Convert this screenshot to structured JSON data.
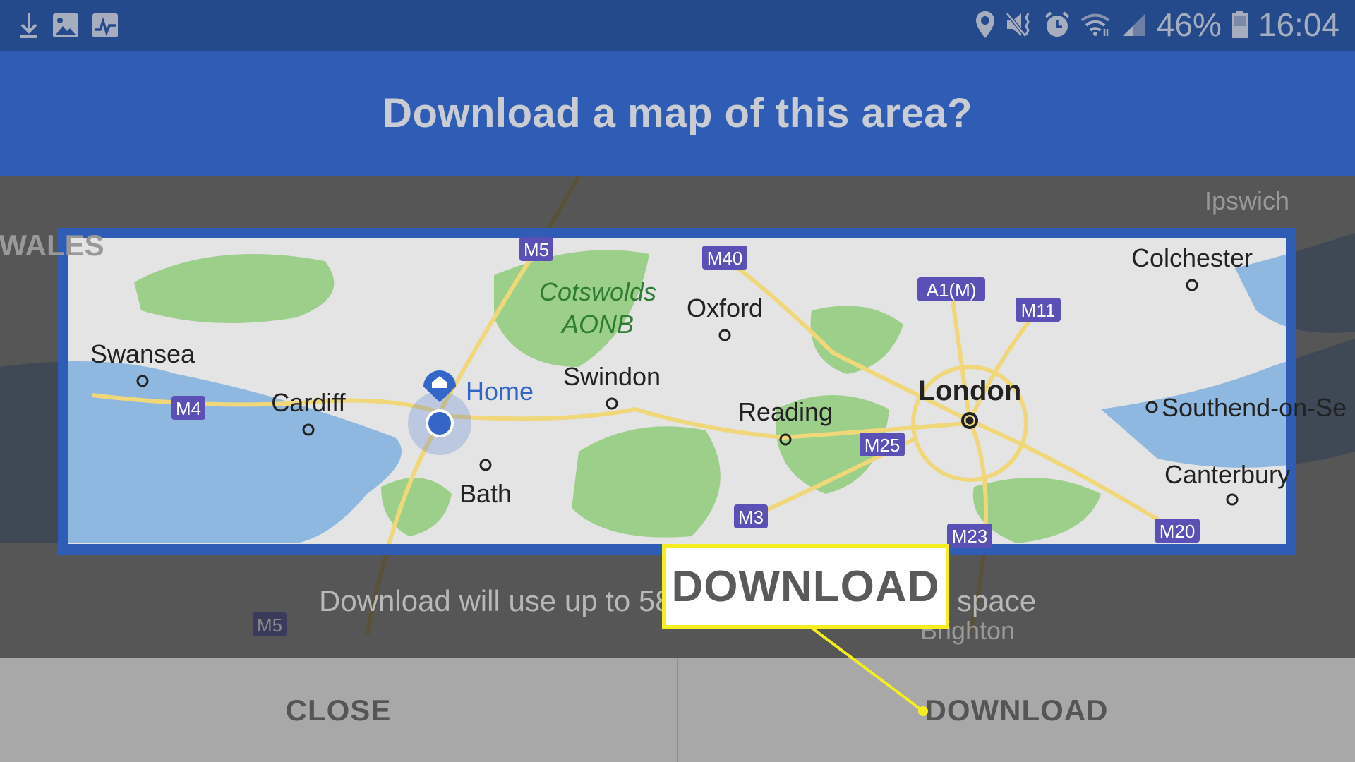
{
  "status_bar": {
    "left_icons": [
      "download-icon",
      "image-icon",
      "activity-icon"
    ],
    "right_icons": [
      "location-icon",
      "mute-vibrate-icon",
      "alarm-icon",
      "wifi-icon",
      "signal-icon",
      "battery-icon"
    ],
    "battery": "46%",
    "time": "16:04"
  },
  "dialog": {
    "title": "Download a map of this area?",
    "usage_text_start": "Download will use up to 58",
    "usage_text_end": "space",
    "close_label": "CLOSE",
    "download_label": "DOWNLOAD"
  },
  "callout": {
    "label": "DOWNLOAD",
    "color": "#f5ee1f"
  },
  "map": {
    "places": {
      "swansea": "Swansea",
      "cardiff": "Cardiff",
      "home": "Home",
      "swindon": "Swindon",
      "bath": "Bath",
      "cotswolds1": "Cotswolds",
      "cotswolds2": "AONB",
      "oxford": "Oxford",
      "reading": "Reading",
      "london": "London",
      "colchester": "Colchester",
      "southend": "Southend-on-Se",
      "canterbury": "Canterbury",
      "ipswich": "Ipswich",
      "wales": "WALES",
      "brighton": "Brighton"
    },
    "roads": [
      "M5",
      "M40",
      "A1(M)",
      "M11",
      "M4",
      "M25",
      "M3",
      "M23",
      "M20",
      "M5"
    ],
    "colors": {
      "frame": "#2f5db5",
      "land": "#e6e6e6",
      "park": "#9ccf8a",
      "water": "#8fb8e0",
      "road": "#f0d77a",
      "shield": "#5a50b5"
    }
  }
}
